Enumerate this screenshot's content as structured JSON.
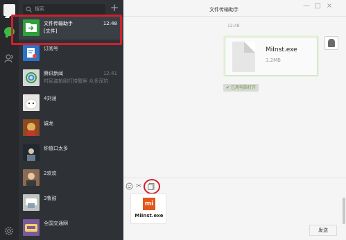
{
  "rail": {
    "icons": [
      "avatar-icon",
      "chat-icon",
      "contacts-icon",
      "settings-icon"
    ]
  },
  "search": {
    "placeholder": "搜索",
    "add": "+"
  },
  "sessions": [
    {
      "name": "文件传输助手",
      "sub": "[文件]",
      "time": "12:48",
      "avatar_color": "#2ea13a",
      "active": true
    },
    {
      "name": "订阅号",
      "sub": "",
      "time": "",
      "avatar_color": "#2c72c7",
      "active": false
    },
    {
      "name": "腾讯新闻",
      "sub": "村民盗抢刚打捞警察 众多深坑",
      "time": "12:41",
      "avatar_color": "#d7d7d7",
      "active": false
    },
    {
      "name": "4刘涵",
      "sub": "",
      "time": "",
      "avatar_color": "#e8e6e4",
      "active": false
    },
    {
      "name": "诚龙",
      "sub": "",
      "time": "",
      "avatar_color": "#c79b3c",
      "active": false
    },
    {
      "name": "你值口太多",
      "sub": "",
      "time": "",
      "avatar_color": "#202830",
      "active": false
    },
    {
      "name": "2欢欢",
      "sub": "",
      "time": "",
      "avatar_color": "#8a6b52",
      "active": false
    },
    {
      "name": "3鲁鼓",
      "sub": "",
      "time": "",
      "avatar_color": "#bfc6c2",
      "active": false
    },
    {
      "name": "全国交通网",
      "sub": "",
      "time": "",
      "avatar_color": "#7b5a9a",
      "active": false
    }
  ],
  "chat": {
    "title": "文件传输助手",
    "window_buttons": {
      "minimize": "—",
      "maximize": "□",
      "close": "×"
    },
    "message_time": "12:48",
    "file": {
      "name": "MiInst.exe",
      "size": "3.2MB"
    },
    "opened_tag": "已用电脑打开",
    "attachment": {
      "logo": "mi",
      "name": "MiInst.exe"
    },
    "send_label": "发送"
  },
  "colors": {
    "accent_highlight": "#d0202b",
    "rail_bg": "#28292c",
    "list_bg": "#2e3136",
    "bubble_green": "#e8f3dd"
  }
}
